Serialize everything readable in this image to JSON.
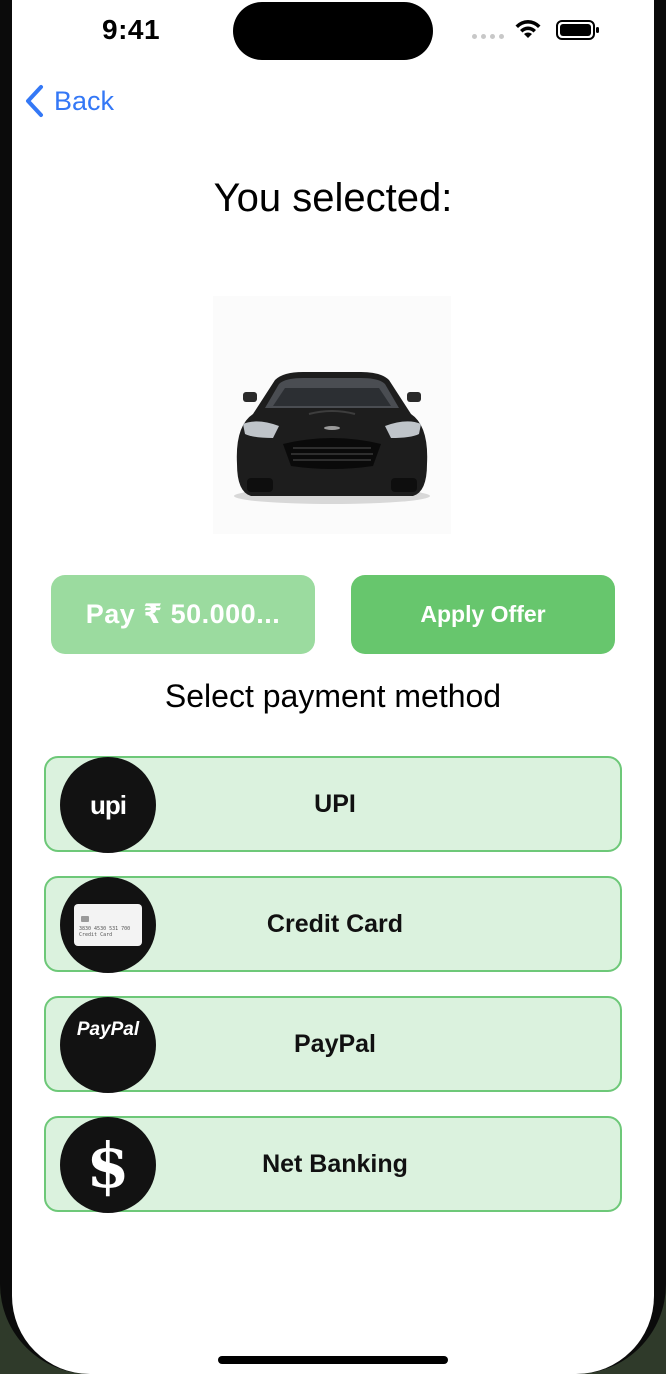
{
  "status_bar": {
    "time": "9:41"
  },
  "nav": {
    "back_label": "Back"
  },
  "title": "You selected:",
  "selected_item": {
    "image": "sports-car-image"
  },
  "actions": {
    "pay_label": "Pay ₹ 50.000...",
    "offer_label": "Apply Offer"
  },
  "subtitle": "Select payment method",
  "payment_methods": [
    {
      "label": "UPI",
      "icon": "upi-icon",
      "icon_text": "upi"
    },
    {
      "label": "Credit Card",
      "icon": "credit-card-icon",
      "card_number": "3830 4530 531 700",
      "card_caption": "Credit Card"
    },
    {
      "label": "PayPal",
      "icon": "paypal-icon",
      "icon_text": "PayPal"
    },
    {
      "label": "Net Banking",
      "icon": "dollar-icon",
      "icon_text": "$"
    }
  ],
  "colors": {
    "accent_blue": "#3478f6",
    "pay_button": "#9bdb9f",
    "offer_button": "#67c66d",
    "row_background": "#dbf2de",
    "row_border": "#6dc878"
  }
}
